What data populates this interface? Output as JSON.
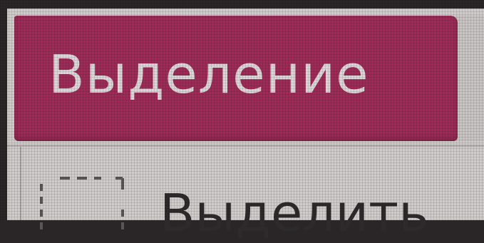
{
  "menu": {
    "header_title": "Выделение",
    "items": [
      {
        "label": "Выделить",
        "icon": "selection-marquee-icon"
      }
    ]
  },
  "colors": {
    "header_background": "#a02a58",
    "header_text": "#ddd6d8",
    "panel_background": "#cfcbcb",
    "item_text": "#2c2a2b"
  }
}
